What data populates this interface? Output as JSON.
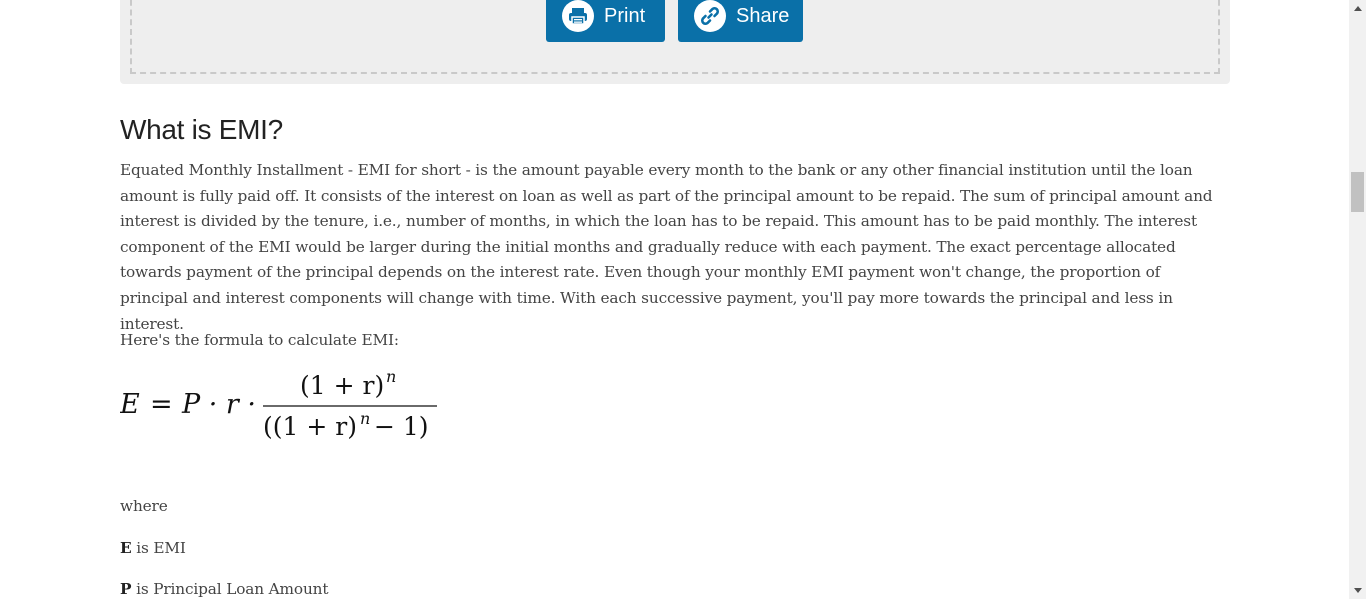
{
  "share_box": {
    "print_label": "Print",
    "share_label": "Share",
    "print_icon": "printer-icon",
    "share_icon": "link-icon",
    "button_color": "#0a70a8"
  },
  "article": {
    "heading": "What is EMI?",
    "intro": "Equated Monthly Installment - EMI for short - is the amount payable every month to the bank or any other financial institution until the loan amount is fully paid off. It consists of the interest on loan as well as part of the principal amount to be repaid. The sum of principal amount and interest is divided by the tenure, i.e., number of months, in which the loan has to be repaid. This amount has to be paid monthly. The interest component of the EMI would be larger during the initial months and gradually reduce with each payment. The exact percentage allocated towards payment of the principal depends on the interest rate. Even though your monthly EMI payment won't change, the proportion of principal and interest components will change with time. With each successive payment, you'll pay more towards the principal and less in interest.",
    "formula_intro": "Here's the formula to calculate EMI:",
    "formula": {
      "lhs": "E",
      "equals": "=",
      "factors": "P · r ·",
      "numerator": "(1 + r)",
      "numerator_exp": "n",
      "denominator": "((1 + r)",
      "denominator_exp": "n",
      "denominator_tail": " − 1)"
    },
    "where": "where",
    "definitions": [
      {
        "symbol": "E",
        "text": " is EMI"
      },
      {
        "symbol": "P",
        "text": " is Principal Loan Amount"
      }
    ]
  },
  "scrollbar": {
    "up_icon": "arrow-up-icon",
    "down_icon": "arrow-down-icon"
  }
}
